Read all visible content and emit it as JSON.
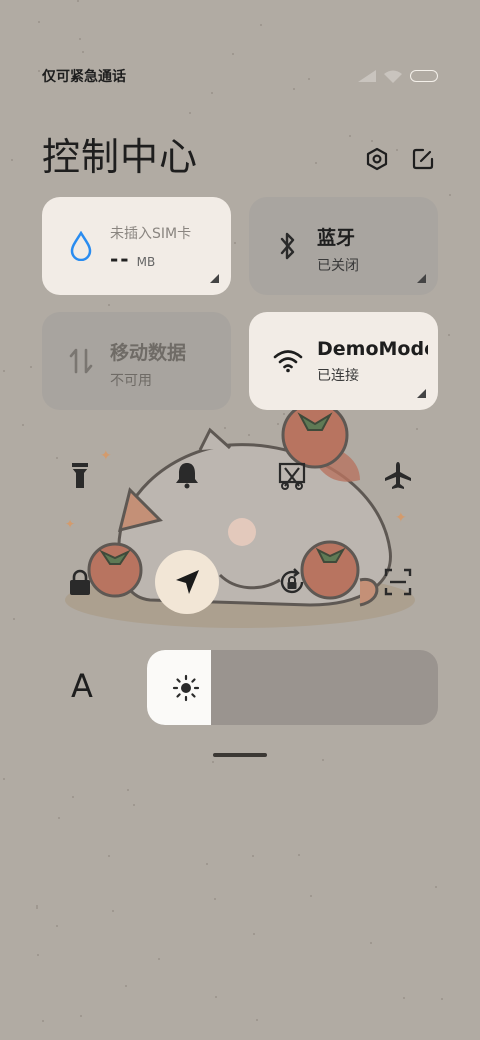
{
  "status": {
    "carrier_text": "仅可紧急通话"
  },
  "header": {
    "title": "控制中心"
  },
  "tiles": {
    "sim": {
      "title": "未插入SIM卡",
      "value": "--",
      "unit": "MB"
    },
    "bluetooth": {
      "title": "蓝牙",
      "status": "已关闭"
    },
    "mobile_data": {
      "title": "移动数据",
      "status": "不可用"
    },
    "wifi": {
      "title": "DemoMode",
      "status": "已连接"
    }
  },
  "quick_toggles": [
    {
      "icon": "flashlight-icon",
      "active": false
    },
    {
      "icon": "bell-icon",
      "active": false
    },
    {
      "icon": "screenshot-icon",
      "active": false
    },
    {
      "icon": "airplane-icon",
      "active": false
    },
    {
      "icon": "lock-icon",
      "active": false
    },
    {
      "icon": "location-icon",
      "active": true
    },
    {
      "icon": "rotation-lock-icon",
      "active": false
    },
    {
      "icon": "scan-icon",
      "active": false
    }
  ],
  "font_button": {
    "label": "A"
  },
  "brightness": {
    "level": 0.22
  },
  "colors": {
    "background": "#b1aba3",
    "tile_on": "#f2ece6",
    "tile_off": "#a9a5a0",
    "accent_blue": "#2a8cf0"
  }
}
